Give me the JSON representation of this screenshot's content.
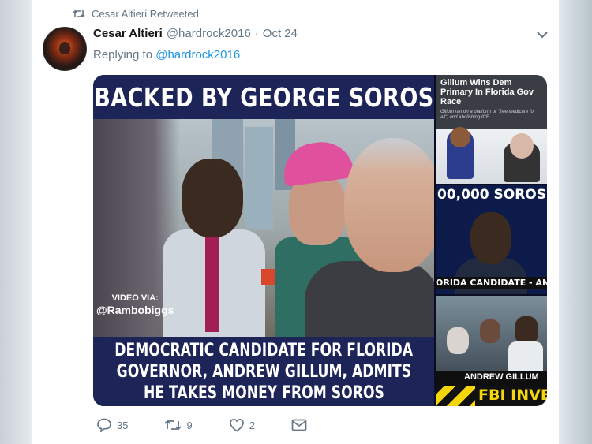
{
  "retweet_context": {
    "text": "Cesar Altieri Retweeted",
    "icon": "retweet-icon"
  },
  "tweet": {
    "author_name": "Cesar Altieri",
    "author_handle": "@hardrock2016",
    "separator": "·",
    "date": "Oct 24",
    "replying_prefix": "Replying to",
    "replying_to": "@hardrock2016",
    "menu_icon": "chevron-down-icon"
  },
  "media": {
    "main": {
      "banner": "BACKED BY GEORGE SOROS",
      "credit_line1": "VIDEO VIA:",
      "credit_line2": "@Rambobiggs",
      "caption_lines": [
        "DEMOCRATIC CANDIDATE FOR FLORIDA",
        "GOVERNOR, ANDREW GILLUM, ADMITS",
        "HE TAKES MONEY FROM SOROS"
      ]
    },
    "thumb1": {
      "title": "Gillum Wins Dem Primary In Florida Gov Race",
      "subtitle": "Gillum ran on a platform of \"free medicare for all\", and abolishing ICE"
    },
    "thumb2": {
      "headline": "00,000 SOROS",
      "bar_text": "ORIDA CANDIDATE - ANDRE"
    },
    "thumb3": {
      "bar_text": "ANDREW GILLUM",
      "fbi_text": "FBI INVES"
    }
  },
  "actions": {
    "reply": {
      "icon": "reply-icon",
      "count": "35"
    },
    "retweet": {
      "icon": "retweet-icon",
      "count": "9"
    },
    "like": {
      "icon": "heart-icon",
      "count": "2"
    },
    "message": {
      "icon": "envelope-icon"
    }
  },
  "colors": {
    "link": "#1b95e0",
    "muted": "#657786",
    "banner_bg": "#1c2458"
  }
}
